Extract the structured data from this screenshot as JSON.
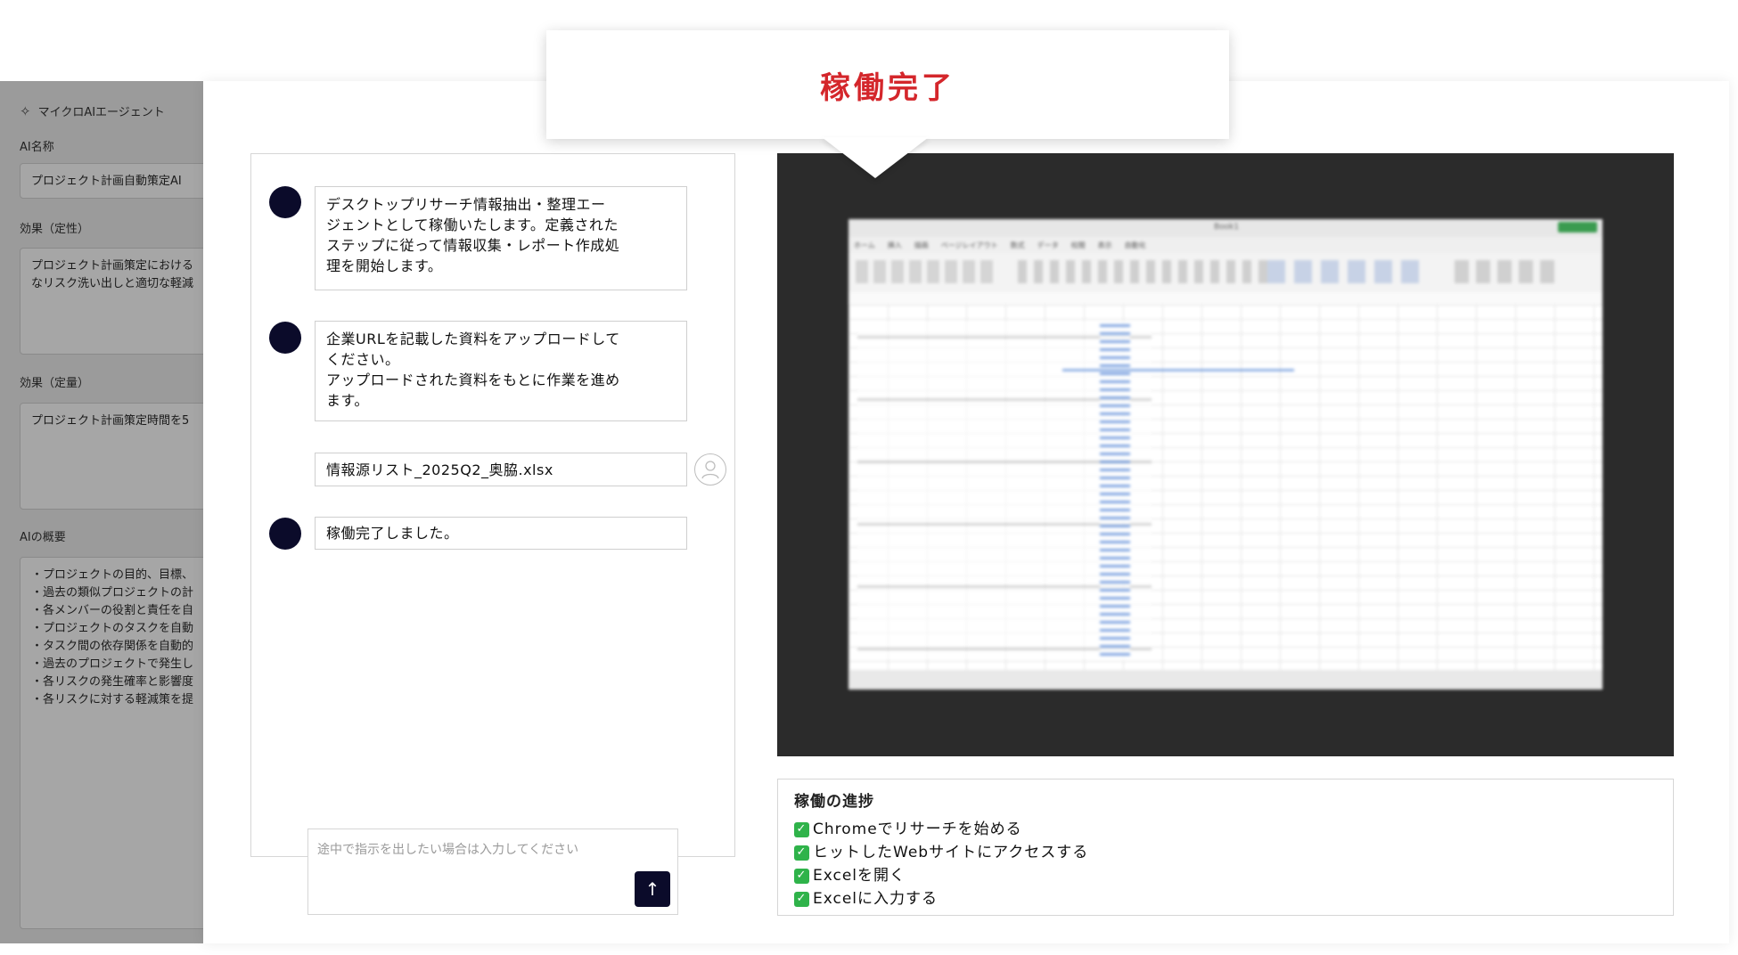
{
  "sidebar": {
    "app_name": "マイクロAIエージェント",
    "ai_name_label": "AI名称",
    "ai_name_value": "プロジェクト計画自動策定AI",
    "effect_qual_label": "効果（定性）",
    "effect_qual_lines": [
      "プロジェクト計画策定における",
      "なリスク洗い出しと適切な軽減"
    ],
    "effect_quant_label": "効果（定量）",
    "effect_quant_lines": [
      "プロジェクト計画策定時間を5"
    ],
    "overview_label": "AIの概要",
    "overview_lines": [
      "・プロジェクトの目的、目標、",
      "・過去の類似プロジェクトの計",
      "・各メンバーの役割と責任を自",
      "・プロジェクトのタスクを自動",
      "・タスク間の依存関係を自動的",
      "・過去のプロジェクトで発生し",
      "・各リスクの発生確率と影響度",
      "・各リスクに対する軽減策を提"
    ]
  },
  "chat": {
    "messages": [
      {
        "lines": [
          "デスクトップリサーチ情報抽出・整理エー",
          "ジェントとして稼働いたします。定義された",
          "ステップに従って情報収集・レポート作成処",
          "理を開始します。"
        ]
      },
      {
        "lines": [
          "企業URLを記載した資料をアップロードして",
          "ください。",
          "アップロードされた資料をもとに作業を進め",
          "ます。"
        ]
      },
      {
        "file": "情報源リスト_2025Q2_奥脇.xlsx"
      },
      {
        "lines": [
          "稼働完了しました。"
        ]
      }
    ],
    "input_placeholder": "途中で指示を出したい場合は入力してください",
    "send_label": "↑"
  },
  "callout": {
    "title": "稼働完了"
  },
  "screen": {
    "window_title": "Book1",
    "tabs": [
      "ホーム",
      "挿入",
      "描画",
      "ページレイアウト",
      "数式",
      "データ",
      "校閲",
      "表示",
      "自動化"
    ]
  },
  "progress": {
    "title": "稼働の進捗",
    "steps": [
      "Chromeでリサーチを始める",
      "ヒットしたWebサイトにアクセスする",
      "Excelを開く",
      "Excelに入力する"
    ]
  },
  "colors": {
    "accent_red": "#d4262b",
    "avatar_navy": "#0b0b2a",
    "check_green": "#2fb34a"
  }
}
